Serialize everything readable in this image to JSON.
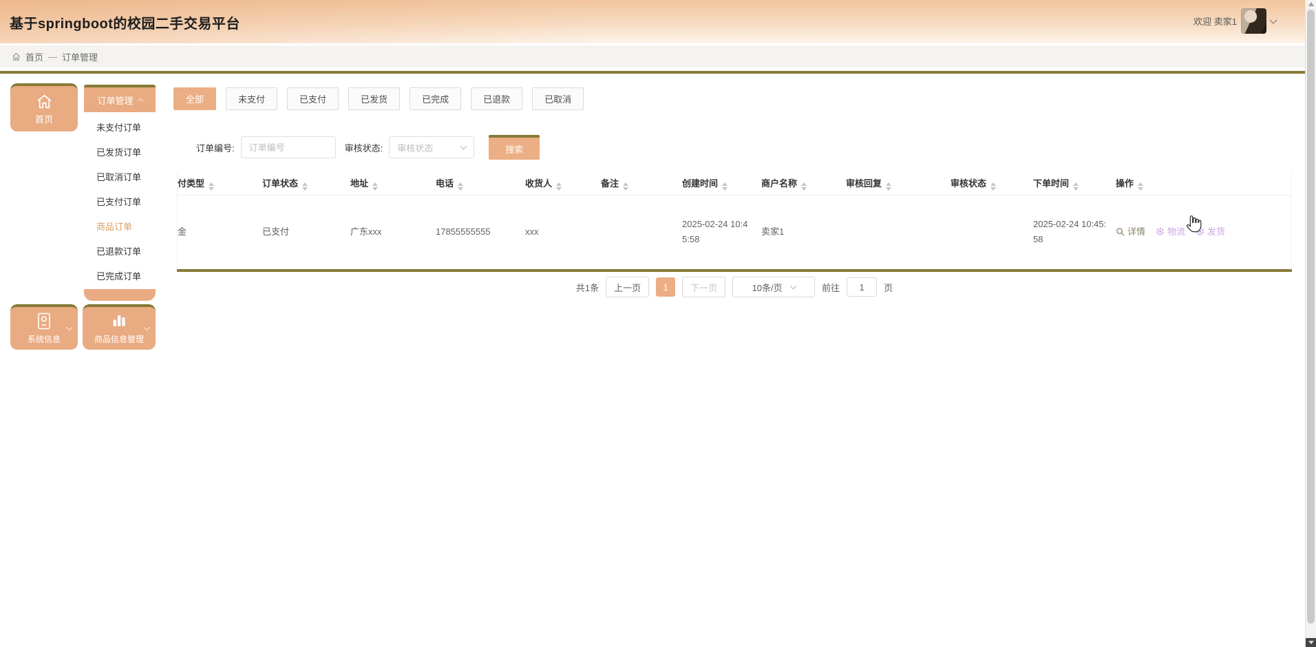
{
  "app": {
    "title": "基于springboot的校园二手交易平台",
    "welcome": "欢迎 卖家1"
  },
  "breadcrumb": {
    "home": "首页",
    "separator": "—",
    "current": "订单管理"
  },
  "sidebar": {
    "home_label": "首页",
    "order_menu_label": "订单管理",
    "order_menu_items": [
      "未支付订单",
      "已发货订单",
      "已取消订单",
      "已支付订单",
      "商品订单",
      "已退款订单",
      "已完成订单"
    ],
    "active_item": "商品订单",
    "system_info_label": "系统信息",
    "product_info_label": "商品信息管理"
  },
  "tabs": [
    "全部",
    "未支付",
    "已支付",
    "已发货",
    "已完成",
    "已退款",
    "已取消"
  ],
  "active_tab": "全部",
  "filters": {
    "order_no_label": "订单编号:",
    "order_no_placeholder": "订单编号",
    "audit_status_label": "审核状态:",
    "audit_status_placeholder": "审核状态",
    "search_button": "搜索"
  },
  "table": {
    "columns": [
      "付类型",
      "订单状态",
      "地址",
      "电话",
      "收货人",
      "备注",
      "创建时间",
      "商户名称",
      "审核回复",
      "审核状态",
      "下单时间",
      "操作"
    ],
    "row": {
      "pay_type": "金",
      "order_status": "已支付",
      "address": "广东xxx",
      "phone": "17855555555",
      "consignee": "xxx",
      "remark": "",
      "create_time": "2025-02-24 10:45:58",
      "merchant_name": "卖家1",
      "audit_reply": "",
      "audit_status": "",
      "order_time": "2025-02-24 10:45:58"
    },
    "actions": {
      "detail": "详情",
      "logistics": "物流",
      "ship": "发货"
    }
  },
  "pagination": {
    "total": "共1条",
    "prev": "上一页",
    "current_page": "1",
    "next": "下一页",
    "page_size": "10条/页",
    "goto_label": "前往",
    "goto_value": "1",
    "page_unit": "页"
  },
  "colors": {
    "accent": "#ecae84",
    "gold": "#867b37",
    "active_menu_item": "#db9f66",
    "action_purple": "#cba4e4"
  }
}
